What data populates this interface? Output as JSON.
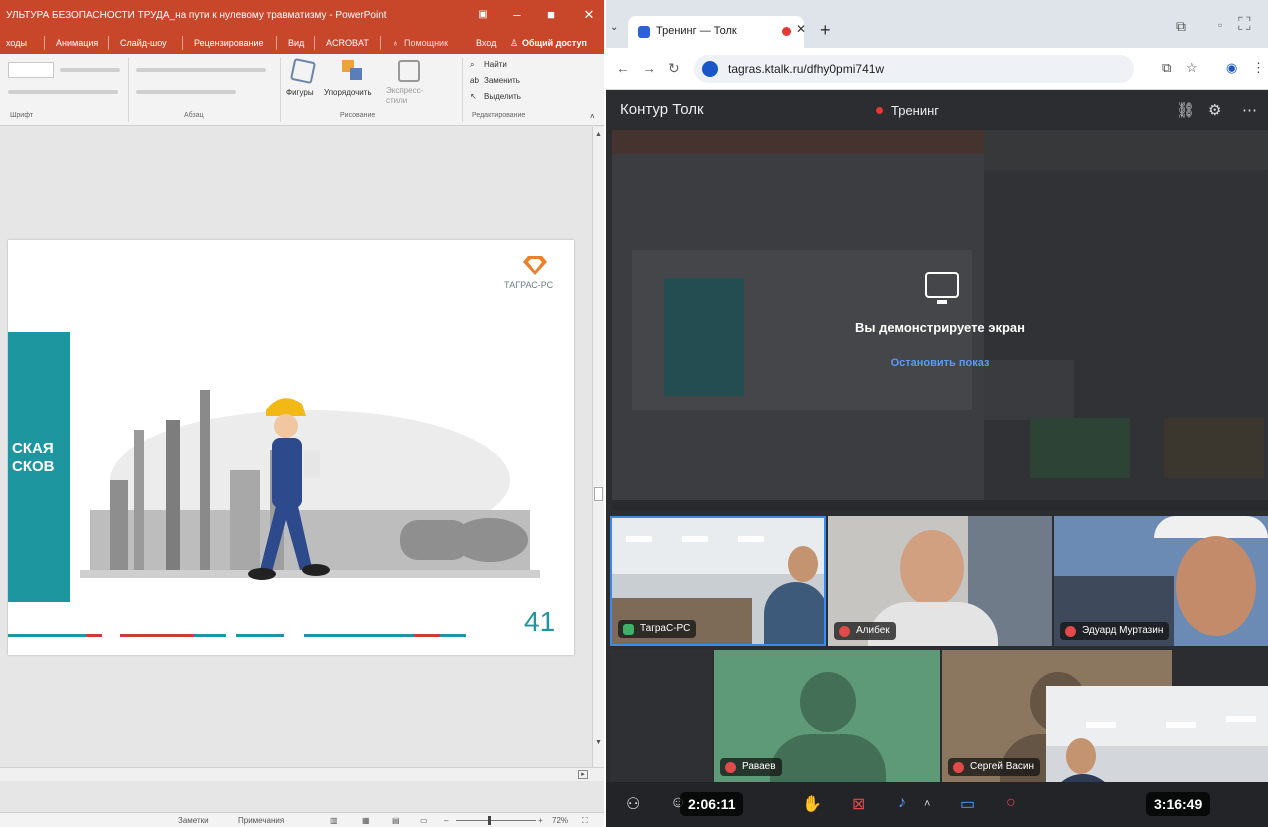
{
  "powerpoint": {
    "title": "УЛЬТУРА БЕЗОПАСНОСТИ ТРУДА_на пути к нулевому травматизму - PowerPoint",
    "tabs": [
      "ходы",
      "Анимация",
      "Слайд-шоу",
      "Рецензирование",
      "Вид",
      "ACROBAT",
      "Помощник",
      "Вход",
      "Общий доступ"
    ],
    "ribbon": {
      "find": "Найти",
      "replace": "Заменить",
      "select": "Выделить",
      "shapes": "Фигуры",
      "arrange": "Упорядочить",
      "quick_styles": "Экспресс-стили",
      "groups": [
        "Шрифт",
        "Абзац",
        "Рисование",
        "Редактирование"
      ]
    },
    "slide": {
      "heading_line1": "СКАЯ",
      "heading_line2": "СКОВ",
      "logo_text": "ТАГРАС-РС",
      "number": "41"
    },
    "status": {
      "notes": "Заметки",
      "comments": "Примечания",
      "zoom": "72%"
    }
  },
  "browser": {
    "tab_title": "Тренинг — Толк",
    "url": "tagras.ktalk.ru/dfhy0pmi741w"
  },
  "ktalk": {
    "brand": "Контур Толк",
    "meeting_name": "Тренинг",
    "share_message": "Вы демонстрируете экран",
    "stop_share": "Остановить показ",
    "participants": [
      {
        "name": "ТаграС-РС"
      },
      {
        "name": "Алибек"
      },
      {
        "name": "Эдуард Муртазин"
      },
      {
        "name": "Раваев"
      },
      {
        "name": "Сергей Васин"
      }
    ],
    "timer_left": "2:06:11",
    "timer_right": "3:16:49"
  },
  "colors": {
    "ppt_accent": "#c8472b",
    "slide_teal": "#1e96a0",
    "record_red": "#e53935",
    "link_blue": "#5b9bf5"
  }
}
